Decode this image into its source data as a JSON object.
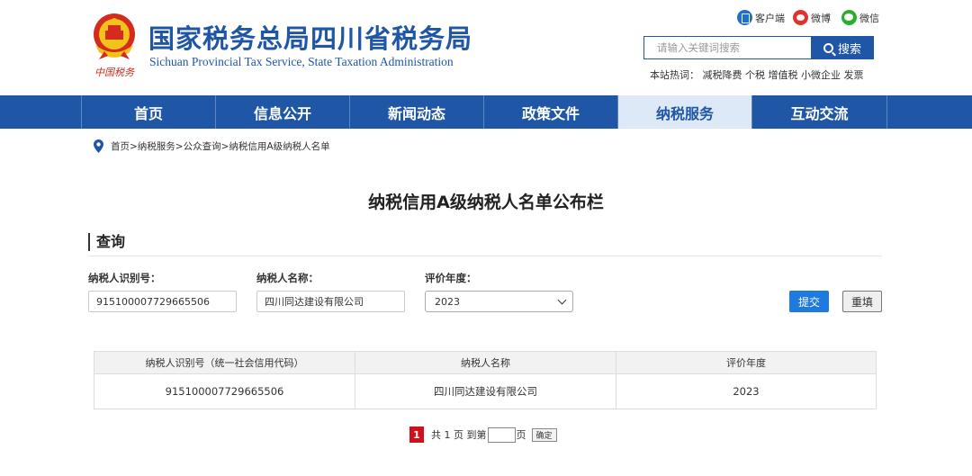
{
  "header": {
    "title_cn": "国家税务总局四川省税务局",
    "title_en": "Sichuan Provincial Tax Service, State Taxation Administration",
    "emblem_caption": "中国税务",
    "social": [
      {
        "label": "客户端",
        "icon": "phone-icon",
        "color": "#1f6fd0"
      },
      {
        "label": "微博",
        "icon": "weibo-icon",
        "color": "#e1322f"
      },
      {
        "label": "微信",
        "icon": "wechat-icon",
        "color": "#2bae2b"
      }
    ],
    "search_placeholder": "请输入关键词搜索",
    "search_button": "搜索",
    "hot_label": "本站热词：",
    "hot_words": "减税降费 个税 增值税 小微企业 发票"
  },
  "nav": {
    "items": [
      "首页",
      "信息公开",
      "新闻动态",
      "政策文件",
      "纳税服务",
      "互动交流"
    ],
    "active_index": 4,
    "color": "#1f56a6"
  },
  "breadcrumb": "首页>纳税服务>公众查询>纳税信用A级纳税人名单",
  "page_title": "纳税信用A级纳税人名单公布栏",
  "query": {
    "section_title": "查询",
    "taxpayer_id_label": "纳税人识别号：",
    "taxpayer_id_value": "915100007729665506",
    "taxpayer_name_label": "纳税人名称：",
    "taxpayer_name_value": "四川同达建设有限公司",
    "year_label": "评价年度：",
    "year_value": "2023",
    "submit_label": "提交",
    "reset_label": "重填"
  },
  "results": {
    "columns": [
      "纳税人识别号（统一社会信用代码）",
      "纳税人名称",
      "评价年度"
    ],
    "rows": [
      [
        "915100007729665506",
        "四川同达建设有限公司",
        "2023"
      ]
    ]
  },
  "pagination": {
    "current_page": "1",
    "total_text": "共 1 页 到第",
    "page_suffix": "页",
    "go_label": "确定"
  }
}
